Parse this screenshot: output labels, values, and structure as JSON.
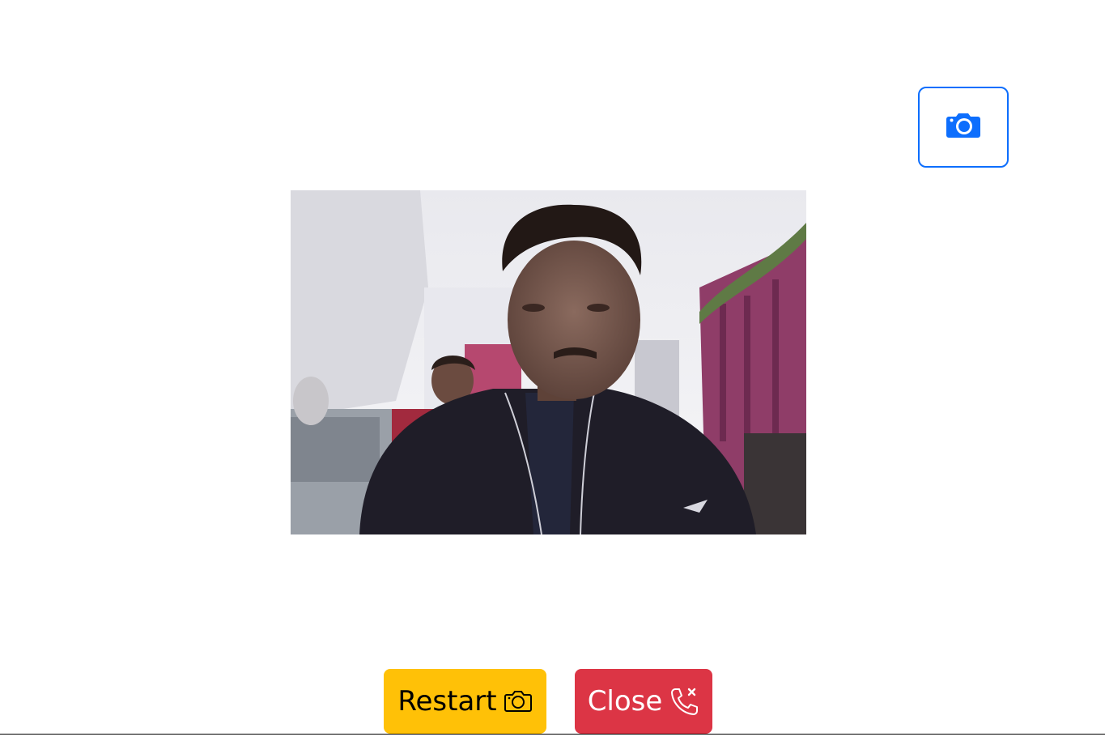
{
  "capture": {
    "icon": "camera-fill-icon",
    "accent_color": "#0d6efd"
  },
  "video": {
    "content": "webcam-feed"
  },
  "controls": {
    "restart": {
      "label": "Restart",
      "icon": "camera-outline-icon",
      "color": "#ffc107"
    },
    "close": {
      "label": "Close",
      "icon": "phone-x-icon",
      "color": "#dc3545"
    }
  }
}
